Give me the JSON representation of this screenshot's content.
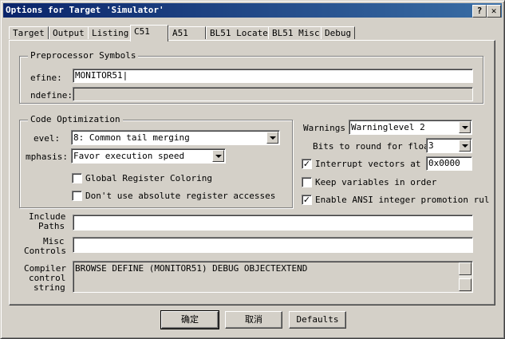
{
  "window": {
    "title": "Options for Target 'Simulator'",
    "help_label": "?",
    "close_label": "✕"
  },
  "tabs": [
    {
      "label": "Target"
    },
    {
      "label": "Output"
    },
    {
      "label": "Listing"
    },
    {
      "label": "C51",
      "active": true
    },
    {
      "label": "A51"
    },
    {
      "label": "BL51 Locate"
    },
    {
      "label": "BL51 Misc"
    },
    {
      "label": "Debug"
    }
  ],
  "preprocessor": {
    "group_title": "Preprocessor Symbols",
    "define_label": "efine:",
    "define_value": "MONITOR51",
    "undefine_label": "ndefine:",
    "undefine_value": ""
  },
  "code_opt": {
    "group_title": "Code Optimization",
    "level_label": "evel:",
    "level_value": "8: Common tail merging",
    "emphasis_label": "mphasis:",
    "emphasis_value": "Favor execution speed",
    "global_reg_label": "Global Register Coloring",
    "global_reg_checked": false,
    "dont_use_abs_label": "Don't use absolute register accesses",
    "dont_use_abs_checked": false
  },
  "right": {
    "warnings_label": "Warnings",
    "warnings_value": "Warninglevel 2",
    "bits_label": "Bits to round for float",
    "bits_value": "3",
    "interrupt_label": "Interrupt vectors at a",
    "interrupt_checked": true,
    "interrupt_value": "0x0000",
    "keep_vars_label": "Keep variables in order",
    "keep_vars_checked": false,
    "ansi_label": "Enable ANSI integer promotion rul",
    "ansi_checked": true
  },
  "paths": {
    "include_label_1": "Include",
    "include_label_2": "Paths",
    "include_value": "",
    "misc_label_1": "Misc",
    "misc_label_2": "Controls",
    "misc_value": "",
    "compiler_label_1": "Compiler",
    "compiler_label_2": "control",
    "compiler_label_3": "string",
    "compiler_value": "BROWSE DEFINE (MONITOR51) DEBUG OBJECTEXTEND"
  },
  "buttons": {
    "ok": "确定",
    "cancel": "取消",
    "defaults": "Defaults"
  }
}
